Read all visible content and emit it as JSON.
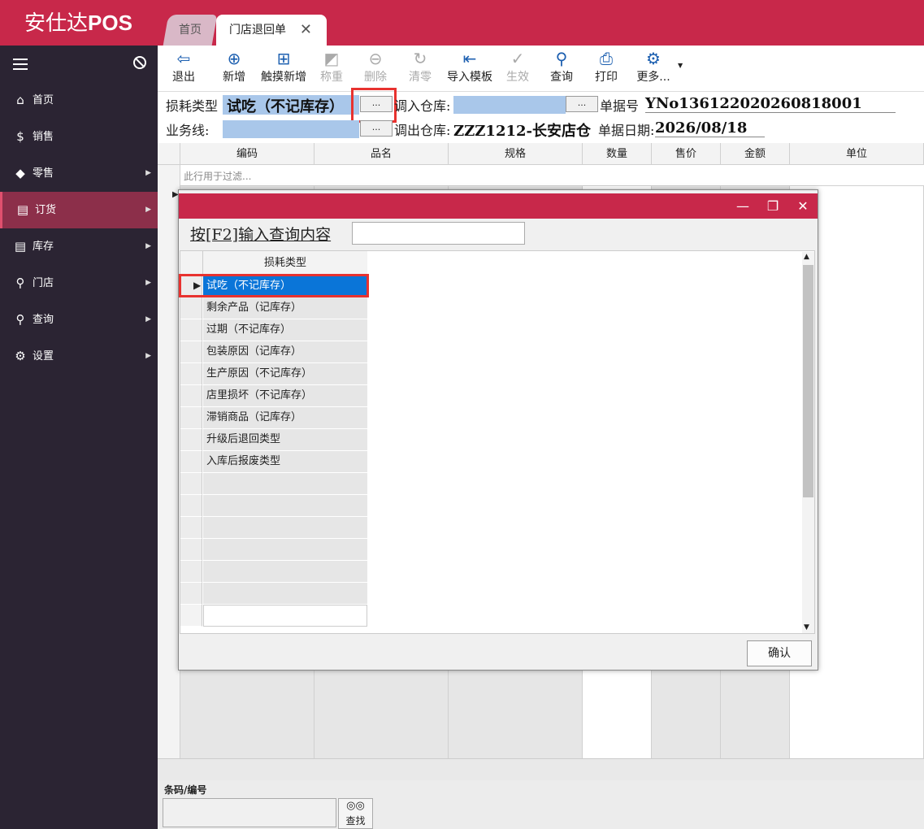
{
  "app": {
    "title_cn": "安仕达",
    "title_en": "POS"
  },
  "tabs": [
    {
      "label": "首页"
    },
    {
      "label": "门店退回单"
    }
  ],
  "sidebar": {
    "items": [
      {
        "label": "首页",
        "icon": "home-icon"
      },
      {
        "label": "销售",
        "icon": "dollar-icon"
      },
      {
        "label": "零售",
        "icon": "tag-icon"
      },
      {
        "label": "订货",
        "icon": "database-icon"
      },
      {
        "label": "库存",
        "icon": "database-icon"
      },
      {
        "label": "门店",
        "icon": "search-icon"
      },
      {
        "label": "查询",
        "icon": "search-icon"
      },
      {
        "label": "设置",
        "icon": "gear-icon"
      }
    ]
  },
  "toolbar": {
    "buttons": [
      {
        "label": "退出",
        "icon": "exit-icon"
      },
      {
        "label": "新增",
        "icon": "plus-circle-icon"
      },
      {
        "label": "触摸新增",
        "icon": "add-file-icon"
      },
      {
        "label": "称重",
        "icon": "scale-icon"
      },
      {
        "label": "删除",
        "icon": "minus-circle-icon"
      },
      {
        "label": "清零",
        "icon": "reset-icon"
      },
      {
        "label": "导入模板",
        "icon": "import-icon"
      },
      {
        "label": "生效",
        "icon": "check-circle-icon"
      },
      {
        "label": "查询",
        "icon": "search-icon"
      },
      {
        "label": "打印",
        "icon": "printer-icon"
      },
      {
        "label": "更多...",
        "icon": "gear-icon"
      }
    ]
  },
  "form": {
    "loss_type_label": "损耗类型",
    "loss_type_value": "试吃（不记库存）",
    "in_warehouse_label": "调入仓库:",
    "doc_no_label": "单据号",
    "doc_no_value": "YNo136122020260818001",
    "business_line_label": "业务线:",
    "out_warehouse_label": "调出仓库:",
    "out_warehouse_value": "ZZZ1212-长安店仓",
    "doc_date_label": "单据日期:",
    "doc_date_value": "2026/08/18",
    "ellipsis": "..."
  },
  "grid": {
    "columns": [
      "编码",
      "品名",
      "规格",
      "数量",
      "售价",
      "金额",
      "单位"
    ],
    "filter_placeholder": "此行用于过滤..."
  },
  "bottom": {
    "barcode_label": "条码/编号",
    "find_label": "查找"
  },
  "dialog": {
    "query_label": "按[F2]输入查询内容",
    "column_header": "损耗类型",
    "items": [
      "试吃（不记库存）",
      "剩余产品（记库存）",
      "过期（不记库存）",
      "包装原因（记库存）",
      "生产原因（不记库存）",
      "店里损坏（不记库存）",
      "滞销商品（记库存）",
      "升级后退回类型",
      "入库后报废类型"
    ],
    "selected_index": 0,
    "confirm_label": "确认"
  },
  "colors": {
    "brand": "#c8284a",
    "sidebar": "#2b2433",
    "selection": "#0a75d8",
    "highlight_box": "#e8322f"
  }
}
